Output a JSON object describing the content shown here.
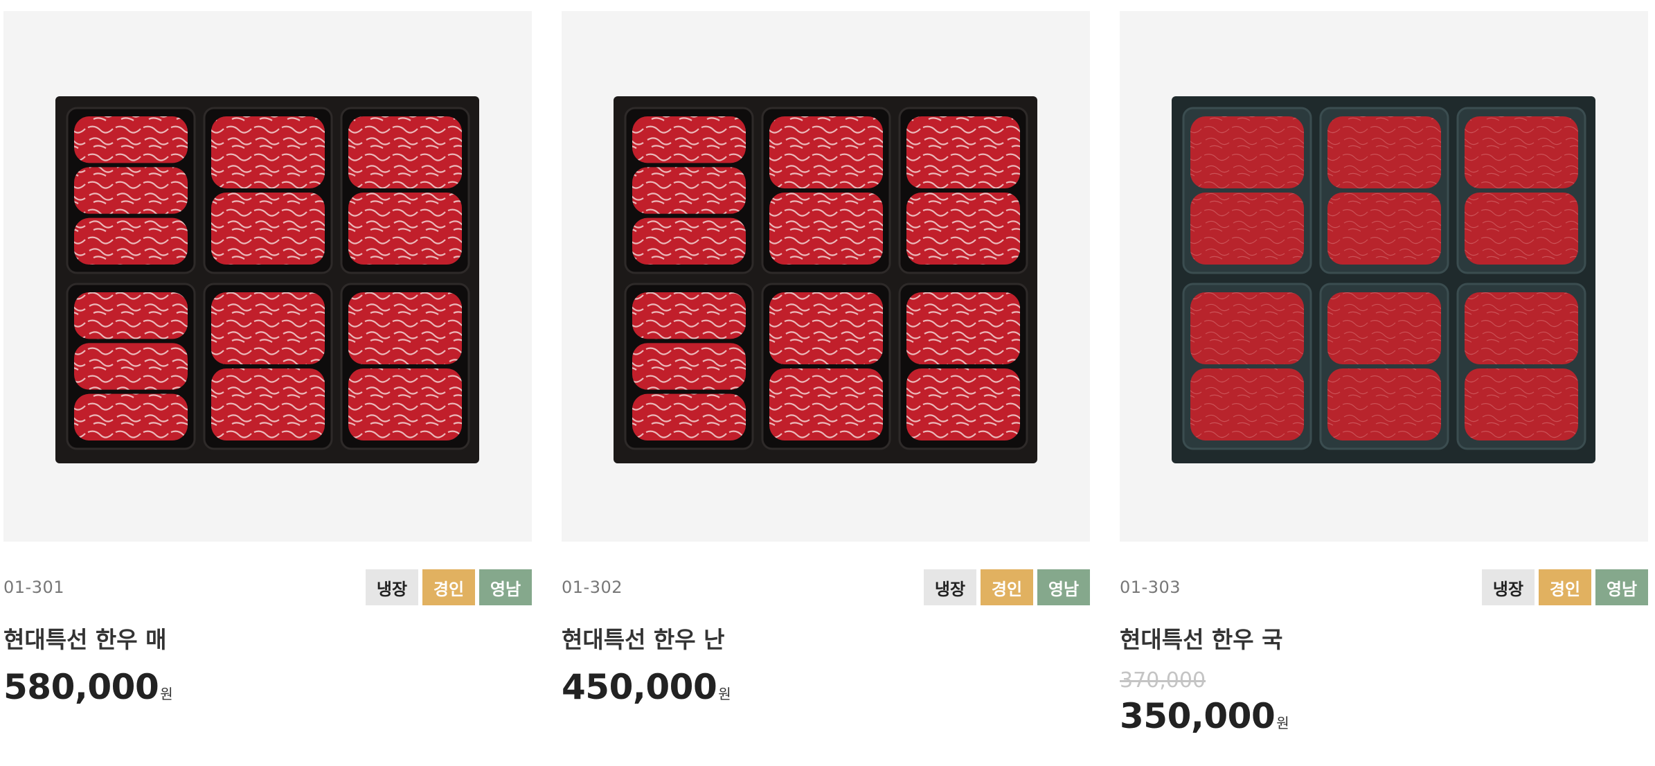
{
  "products": [
    {
      "code": "01-301",
      "tags": [
        "냉장",
        "경인",
        "영남"
      ],
      "name": "현대특선 한우 매",
      "price": "580,000",
      "unit": "원",
      "image": "hanwoo-gift-box-black-tray"
    },
    {
      "code": "01-302",
      "tags": [
        "냉장",
        "경인",
        "영남"
      ],
      "name": "현대특선 한우 난",
      "price": "450,000",
      "unit": "원",
      "image": "hanwoo-gift-box-black-tray"
    },
    {
      "code": "01-303",
      "tags": [
        "냉장",
        "경인",
        "영남"
      ],
      "name": "현대특선 한우 국",
      "original_price": "370,000",
      "price": "350,000",
      "unit": "원",
      "image": "hanwoo-gift-box-dark-green-tray"
    }
  ],
  "colors": {
    "tag_cold": "#e6e6e6",
    "tag_gyeongin": "#e1b160",
    "tag_yeongnam": "#85a88c",
    "photo_bg": "#f4f4f4"
  }
}
